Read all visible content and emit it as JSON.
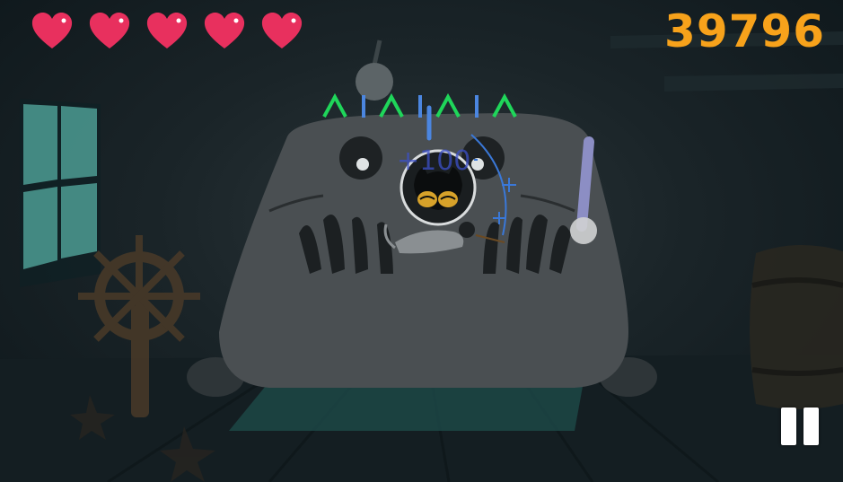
{
  "hud": {
    "lives": 5,
    "score": "39796"
  },
  "popup": {
    "points_text": "+100"
  },
  "enemy": {
    "symbol_sequence": [
      "caret",
      "bar",
      "caret",
      "bar",
      "caret",
      "bar",
      "caret"
    ],
    "caret_color": "#1fd65a",
    "bar_color": "#4b86e0"
  },
  "icons": {
    "lives": "heart-icon",
    "pause": "pause-icon"
  },
  "colors": {
    "heart": "#e8305e",
    "score": "#f7a21b",
    "background": "#1a2428"
  }
}
